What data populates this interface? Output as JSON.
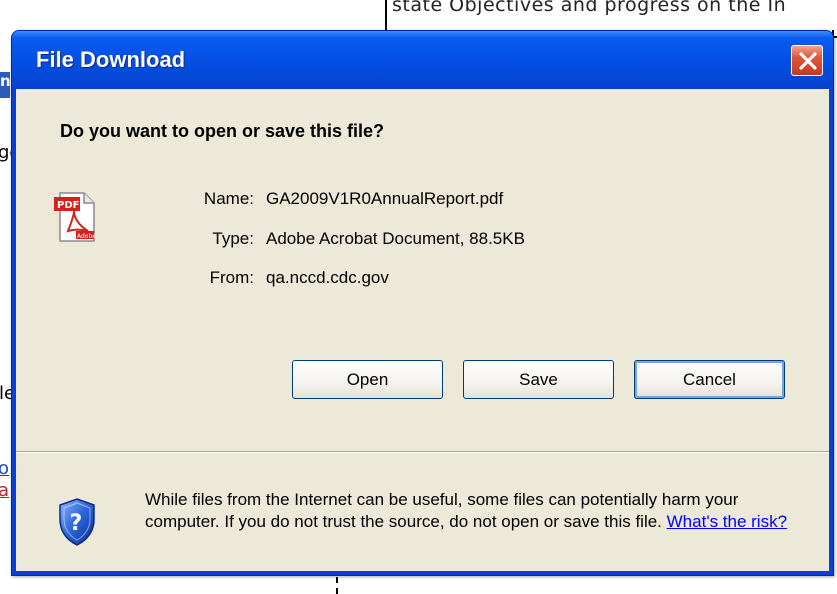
{
  "background": {
    "top_text": "state Objectives and progress on the In",
    "left_fragments": [
      "nc",
      "ge",
      "le",
      "o",
      "a"
    ]
  },
  "dialog": {
    "title": "File Download",
    "question": "Do you want to open or save this file?",
    "file": {
      "icon": "pdf-file-icon",
      "name_label": "Name:",
      "name_value": "GA2009V1R0AnnualReport.pdf",
      "type_label": "Type:",
      "type_value": "Adobe Acrobat Document, 88.5KB",
      "from_label": "From:",
      "from_value": "qa.nccd.cdc.gov"
    },
    "buttons": {
      "open": "Open",
      "save": "Save",
      "cancel": "Cancel"
    },
    "warning": {
      "text": "While files from the Internet can be useful, some files can potentially harm your computer. If you do not trust the source, do not open or save this file.",
      "link": "What's the risk?"
    }
  },
  "colors": {
    "titlebar": "#0550e6",
    "client": "#ece9d8",
    "close": "#e0553a",
    "link": "#0000ff"
  }
}
